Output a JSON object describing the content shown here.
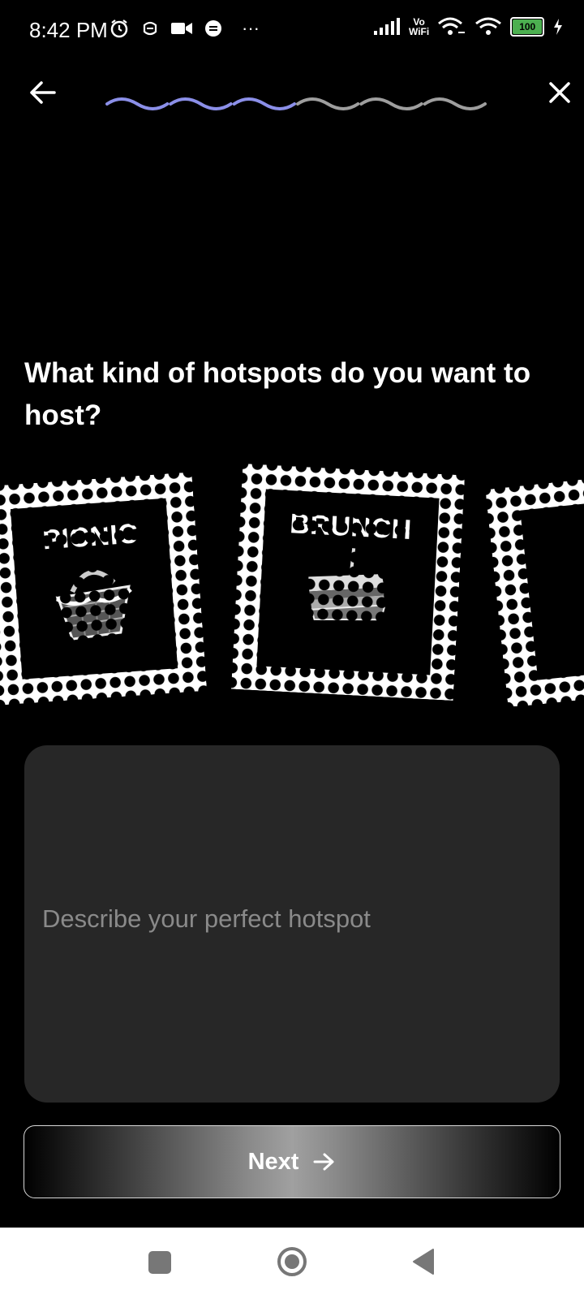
{
  "status_bar": {
    "time": "8:42 PM",
    "battery": "100",
    "vowifi_top": "Vo",
    "vowifi_bottom": "WiFi",
    "more": "···"
  },
  "header": {
    "back_icon": "arrow-left-icon",
    "close_icon": "close-icon",
    "progress": {
      "completed_steps": 3,
      "total_steps": 6,
      "active_color": "#8b8fe8",
      "inactive_color": "#9e9e9e"
    }
  },
  "question": {
    "title": "What kind of hotspots do you want to host?"
  },
  "hotspot_options": [
    {
      "label": "PICNIC",
      "icon": "picnic-basket-icon"
    },
    {
      "label": "BRUNCH",
      "icon": "sandwich-icon"
    },
    {
      "label": "",
      "icon": ""
    }
  ],
  "description": {
    "placeholder": "Describe your perfect hotspot",
    "value": ""
  },
  "next_button": {
    "label": "Next",
    "icon": "arrow-right-icon"
  },
  "nav_bar": {
    "recents_icon": "square-icon",
    "home_icon": "home-circle-icon",
    "back_icon": "triangle-back-icon"
  },
  "colors": {
    "background": "#000000",
    "field": "#272727",
    "accent": "#8b8fe8"
  }
}
